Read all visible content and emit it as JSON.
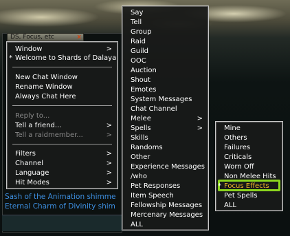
{
  "chat": {
    "tab_label": "DS, Focus, etc",
    "close_glyph": "x",
    "lines": [
      "Sash of the Animation shimme",
      "Eternal Charm of Divinity shim"
    ]
  },
  "main_menu": {
    "items": [
      {
        "label": "Window",
        "arrow": ">"
      },
      {
        "label": "Welcome to Shards of Dalaya",
        "star": "*"
      },
      {
        "label": "New Chat Window"
      },
      {
        "label": "Rename Window"
      },
      {
        "label": "Always Chat Here"
      },
      {
        "label": "Reply to..."
      },
      {
        "label": "Tell a friend...",
        "arrow": ">"
      },
      {
        "label": "Tell a raidmember...",
        "arrow": ">"
      },
      {
        "label": "Filters",
        "arrow": ">"
      },
      {
        "label": "Channel",
        "arrow": ">"
      },
      {
        "label": "Language",
        "arrow": ">"
      },
      {
        "label": "Hit Modes",
        "arrow": ">"
      }
    ]
  },
  "channel_menu": {
    "items": [
      {
        "label": "Say"
      },
      {
        "label": "Tell"
      },
      {
        "label": "Group"
      },
      {
        "label": "Raid"
      },
      {
        "label": "Guild"
      },
      {
        "label": "OOC"
      },
      {
        "label": "Auction"
      },
      {
        "label": "Shout"
      },
      {
        "label": "Emotes"
      },
      {
        "label": "System Messages"
      },
      {
        "label": "Chat Channel"
      },
      {
        "label": "Melee",
        "arrow": ">"
      },
      {
        "label": "Spells",
        "arrow": ">"
      },
      {
        "label": "Skills"
      },
      {
        "label": "Randoms"
      },
      {
        "label": "Other"
      },
      {
        "label": "Experience Messages"
      },
      {
        "label": "/who"
      },
      {
        "label": "Pet Responses"
      },
      {
        "label": "Item Speech"
      },
      {
        "label": "Fellowship Messages"
      },
      {
        "label": "Mercenary Messages"
      },
      {
        "label": "ALL"
      }
    ]
  },
  "hit_modes_menu": {
    "items": [
      {
        "label": "Mine"
      },
      {
        "label": "Others"
      },
      {
        "label": "Failures"
      },
      {
        "label": "Criticals"
      },
      {
        "label": "Worn Off"
      },
      {
        "label": "Non Melee Hits"
      },
      {
        "label": "Focus Effects",
        "star": "*"
      },
      {
        "label": "Pet Spells"
      },
      {
        "label": "ALL"
      }
    ]
  },
  "colors": {
    "chat_text": "#3d8fe0",
    "highlight_border": "#8cd61e",
    "highlight_text": "#f2b82a",
    "disabled_text": "#8a8a8a"
  }
}
